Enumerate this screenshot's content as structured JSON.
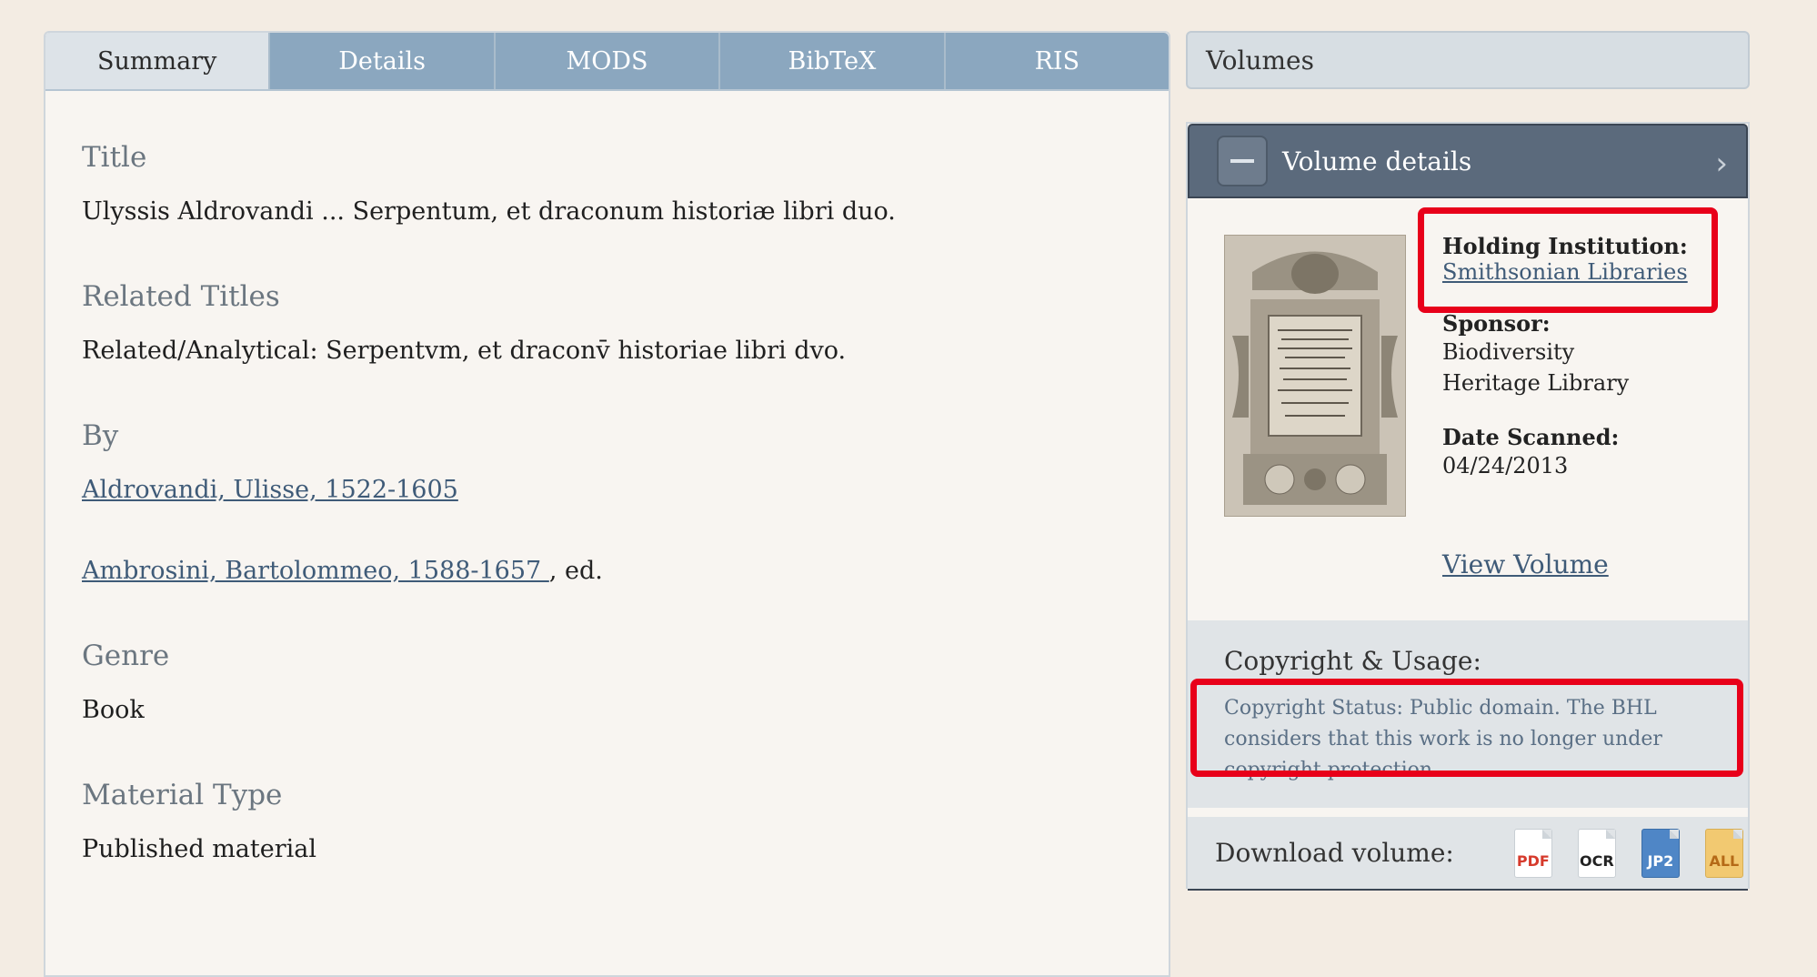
{
  "tabs": [
    {
      "label": "Summary",
      "active": true
    },
    {
      "label": "Details"
    },
    {
      "label": "MODS"
    },
    {
      "label": "BibTeX"
    },
    {
      "label": "RIS"
    }
  ],
  "summary": {
    "title_label": "Title",
    "title_value": "Ulyssis Aldrovandi ... Serpentum, et draconum historiæ libri duo.",
    "related_label": "Related Titles",
    "related_value": "Related/Analytical: Serpentvm, et draconv̄ historiae libri dvo.",
    "by_label": "By",
    "authors": [
      {
        "name": "Aldrovandi, Ulisse, 1522-1605 ",
        "suffix": ""
      },
      {
        "name": "Ambrosini, Bartolommeo, 1588-1657 ",
        "suffix": ", ed."
      }
    ],
    "genre_label": "Genre",
    "genre_value": "Book",
    "material_label": "Material Type",
    "material_value": "Published material"
  },
  "volumes_label": "Volumes",
  "volume_details": {
    "header": "Volume details",
    "holding_label": "Holding Institution:",
    "holding_value": "Smithsonian Libraries",
    "sponsor_label": "Sponsor:",
    "sponsor_value": "Biodiversity Heritage Library",
    "date_label": "Date Scanned:",
    "date_value": "04/24/2013",
    "view_volume": "View Volume",
    "copyright_heading": "Copyright & Usage:",
    "copyright_text": "Copyright Status: Public domain. The BHL considers that this work is no longer under copyright protection.",
    "download_label": "Download volume:",
    "downloads": [
      "PDF",
      "OCR",
      "JP2",
      "ALL"
    ]
  },
  "colors": {
    "highlight": "#e8001a",
    "tab_bar": "#8ba7bf",
    "header_bar": "#5b6a7c"
  }
}
